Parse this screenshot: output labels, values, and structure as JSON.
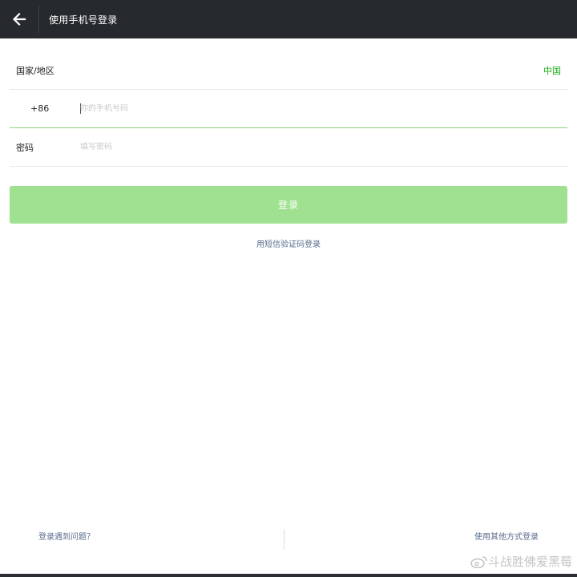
{
  "header": {
    "title": "使用手机号登录",
    "back_icon": "arrow-left-icon"
  },
  "form": {
    "region_label": "国家/地区",
    "region_value": "中国",
    "country_code": "+86",
    "phone_placeholder": "你的手机号码",
    "phone_value": "",
    "password_label": "密码",
    "password_placeholder": "填写密码",
    "password_value": ""
  },
  "actions": {
    "login_label": "登录",
    "sms_login_label": "用短信验证码登录"
  },
  "footer": {
    "trouble_label": "登录遇到问题？",
    "other_methods_label": "使用其他方式登录"
  },
  "watermark": {
    "text": "斗战胜佛爱黑莓"
  },
  "colors": {
    "appbar_bg": "#262a2e",
    "accent": "#1aad19",
    "login_button_disabled": "#a0e191",
    "link": "#5b6b8c"
  }
}
